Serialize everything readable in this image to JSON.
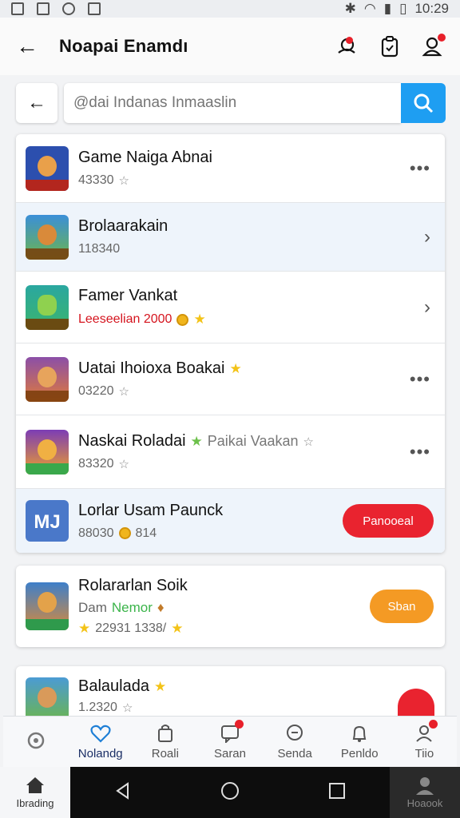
{
  "status_bar": {
    "time": "10:29"
  },
  "header": {
    "title": "Noapai Enamdı",
    "icons": [
      "search-person-icon",
      "clipboard-icon",
      "profile-icon"
    ]
  },
  "search": {
    "placeholder": "@dai Indanas Inmaaslin",
    "value": ""
  },
  "items": [
    {
      "name": "Game Naiga Abnai",
      "sub": "43330",
      "trailing": "more",
      "thumb_color": "#2c4fae"
    },
    {
      "name": "Brolaarakain",
      "sub": "118340",
      "trailing": "chevron",
      "thumb_color": "#3b8fd8"
    },
    {
      "name": "Famer Vankat",
      "sub": "Leeseelian 2000",
      "trailing": "chevron",
      "thumb_color": "#3bb56d"
    },
    {
      "name": "Uatai Ihoioxa Boakai",
      "sub": "03220",
      "trailing": "more",
      "thumb_color": "#8b4fa8"
    },
    {
      "name": "Naskai Roladai",
      "name_extra": "Paikai Vaakan",
      "sub": "83320",
      "trailing": "more",
      "thumb_color": "#7c3db5"
    },
    {
      "name": "Lorlar Usam Paunck",
      "sub": "88030",
      "sub_extra": "814",
      "trailing": "button",
      "button_label": "Panooeal",
      "thumb_text": "MJ",
      "thumb_color": "#4a78c9"
    }
  ],
  "items2": [
    {
      "name": "Rolararlan Soik",
      "sub_prefix": "Dam",
      "sub_green": "Nemor",
      "sub2": "22931 1338/",
      "button_label": "Sban",
      "thumb_color": "#3e7fc9"
    },
    {
      "name": "Balaulada",
      "sub": "1.2320",
      "thumb_color": "#4b9bd4"
    }
  ],
  "bottom_nav": [
    {
      "label": "",
      "icon": "loader-icon"
    },
    {
      "label": "Nolandg",
      "icon": "heart-icon",
      "active": true
    },
    {
      "label": "Roali",
      "icon": "bag-icon"
    },
    {
      "label": "Saran",
      "icon": "chat-icon",
      "badge": true
    },
    {
      "label": "Senda",
      "icon": "message-icon"
    },
    {
      "label": "Penldo",
      "icon": "bell-icon"
    },
    {
      "label": "Tiio",
      "icon": "person-icon",
      "badge": true
    }
  ],
  "system_nav": {
    "left_label": "Ibrading",
    "right_label": "Hoaook"
  }
}
